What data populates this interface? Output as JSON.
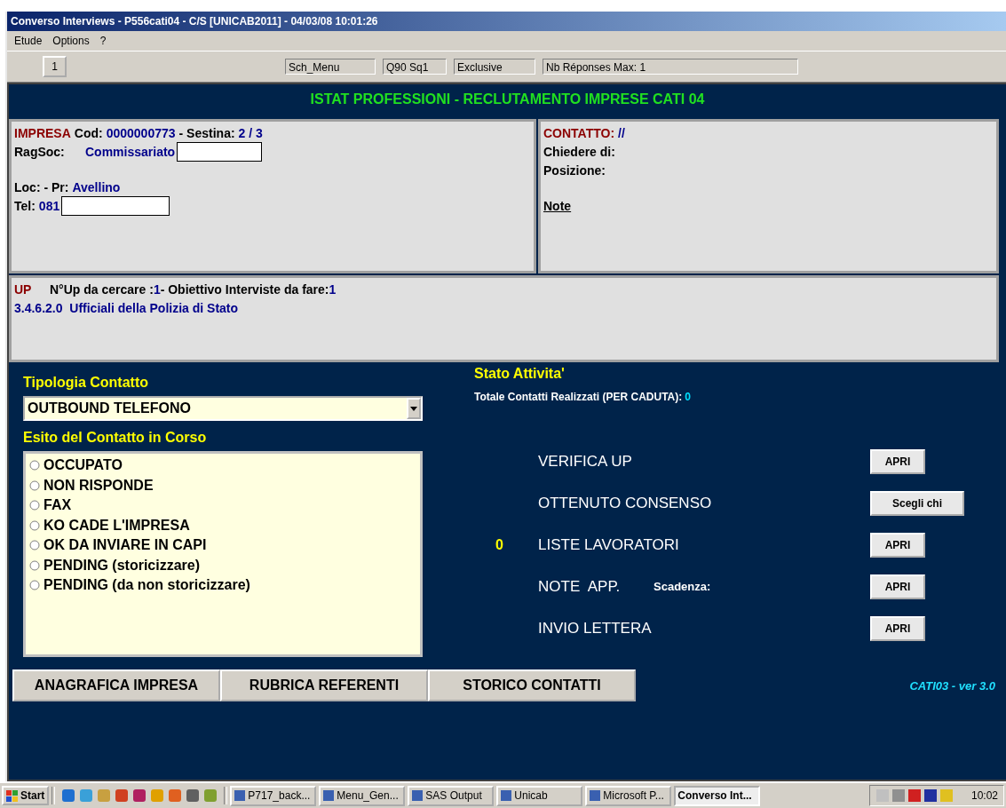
{
  "window": {
    "title": "Converso Interviews - P556cati04 - C/S [UNICAB2011] - 04/03/08 10:01:26"
  },
  "menu": [
    "Etude",
    "Options",
    "?"
  ],
  "toolbar": {
    "page_button": "1",
    "fields": [
      "Sch_Menu",
      "Q90  Sq1",
      "Exclusive",
      "Nb Réponses Max: 1"
    ]
  },
  "header": "ISTAT PROFESSIONI - RECLUTAMENTO IMPRESE  CATI 04",
  "impresa": {
    "title": "IMPRESA",
    "cod_label": "Cod:",
    "cod": "0000000773",
    "sestina_label": "- Sestina:",
    "sestina": "2 / 3",
    "ragsoc_label": "RagSoc:",
    "ragsoc": "Commissariato",
    "loc_label": "Loc:  - Pr:",
    "loc": "Avellino",
    "tel_label": "Tel:",
    "tel": "081"
  },
  "contatto": {
    "title": "CONTATTO:",
    "value": "//",
    "chiedere": "Chiedere di:",
    "posizione": "Posizione:",
    "note": "Note"
  },
  "up": {
    "title": "UP",
    "cercare_label": "N°Up da cercare :",
    "cercare": "1",
    "obiettivo_label": "- Obiettivo Interviste da fare:",
    "obiettivo": "1",
    "code": "3.4.6.2.0  Ufficiali della Polizia di Stato"
  },
  "tipologia": {
    "label": "Tipologia Contatto",
    "value": "OUTBOUND TELEFONO"
  },
  "esito": {
    "label": "Esito del Contatto in Corso",
    "options": [
      {
        "label": "OCCUPATO",
        "selected": false
      },
      {
        "label": "NON RISPONDE",
        "selected": false
      },
      {
        "label": "FAX",
        "selected": false
      },
      {
        "label": "KO CADE L'IMPRESA",
        "selected": false
      },
      {
        "label": "OK DA INVIARE IN CAPI",
        "selected": false
      },
      {
        "label": "PENDING (storicizzare)",
        "selected": false
      },
      {
        "label": "PENDING (da non storicizzare)",
        "selected": false
      }
    ]
  },
  "stato": {
    "title": "Stato Attivita'",
    "totale_label": "Totale Contatti Realizzati (PER CADUTA):",
    "totale": "0"
  },
  "actions": [
    {
      "label": "VERIFICA UP",
      "button": "APRI"
    },
    {
      "label": "OTTENUTO CONSENSO",
      "button": "Scegli chi"
    },
    {
      "label": "LISTE LAVORATORI",
      "count": "0",
      "button": "APRI"
    },
    {
      "label": "NOTE  APP.",
      "extra": "Scadenza:",
      "button": "APRI"
    },
    {
      "label": "INVIO LETTERA",
      "button": "APRI"
    }
  ],
  "bottom_buttons": [
    "ANAGRAFICA IMPRESA",
    "RUBRICA REFERENTI",
    "STORICO CONTATTI"
  ],
  "version": "CATI03 - ver 3.0",
  "taskbar": {
    "start": "Start",
    "tasks": [
      {
        "label": "P717_back...",
        "selected": false
      },
      {
        "label": "Menu_Gen...",
        "selected": false
      },
      {
        "label": "SAS Output",
        "selected": false
      },
      {
        "label": "Unicab",
        "selected": false
      },
      {
        "label": "Microsoft P...",
        "selected": false
      },
      {
        "label": "Converso Int...",
        "selected": true
      }
    ],
    "clock": "10:02"
  }
}
